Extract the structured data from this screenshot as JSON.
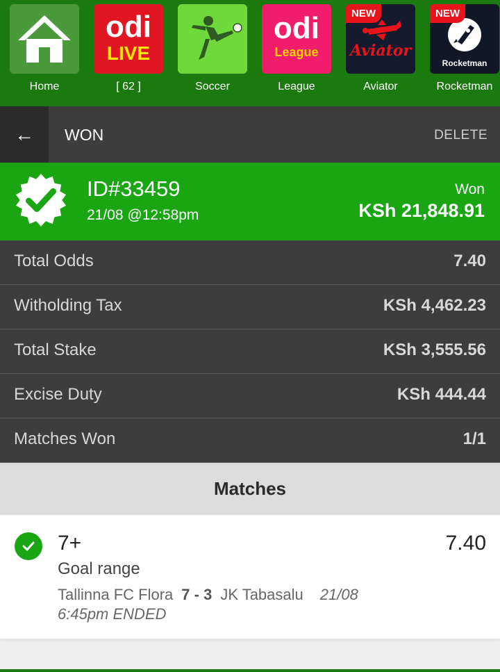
{
  "nav": {
    "items": [
      {
        "label": "Home",
        "icon": "home-icon"
      },
      {
        "label": "[ 62 ]",
        "icon": "odi-live-logo",
        "tile_text_top": "odi",
        "tile_text_bottom": "LIVE"
      },
      {
        "label": "Soccer",
        "icon": "soccer-player-icon"
      },
      {
        "label": "League",
        "icon": "odi-league-logo",
        "tile_text_top": "odi",
        "tile_text_bottom": "League"
      },
      {
        "label": "Aviator",
        "icon": "aviator-plane-icon",
        "badge": "NEW",
        "tile_text": "Aviator"
      },
      {
        "label": "Rocketman",
        "icon": "rocket-icon",
        "badge": "NEW",
        "tile_text": "Rocketman"
      }
    ]
  },
  "header": {
    "back": "←",
    "title": "WON",
    "delete_label": "DELETE"
  },
  "summary": {
    "id": "ID#33459",
    "date": "21/08 @12:58pm",
    "status": "Won",
    "amount": "KSh 21,848.91",
    "colors": {
      "bg": "#1aa512"
    }
  },
  "details": [
    {
      "label": "Total Odds",
      "value": "7.40"
    },
    {
      "label": "Witholding Tax",
      "value": "KSh 4,462.23"
    },
    {
      "label": "Total Stake",
      "value": "KSh 3,555.56"
    },
    {
      "label": "Excise Duty",
      "value": "KSh 444.44"
    },
    {
      "label": "Matches Won",
      "value": "1/1"
    }
  ],
  "matches": {
    "heading": "Matches",
    "items": [
      {
        "pick": "7+",
        "market": "Goal range",
        "odds": "7.40",
        "home": "Tallinna FC Flora",
        "score": "7 - 3",
        "away": "JK Tabasalu",
        "date": "21/08",
        "time_status": "6:45pm ENDED"
      }
    ]
  }
}
